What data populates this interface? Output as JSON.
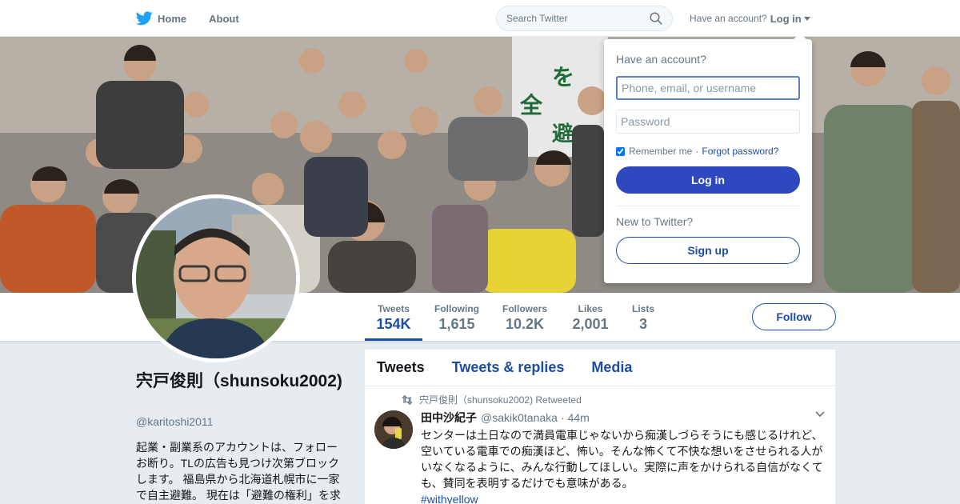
{
  "nav": {
    "home_label": "Home",
    "about_label": "About",
    "search_placeholder": "Search Twitter",
    "account_prompt": "Have an account?",
    "login_label": "Log in"
  },
  "login_dropdown": {
    "heading": "Have an account?",
    "username_placeholder": "Phone, email, or username",
    "password_placeholder": "Password",
    "remember_label": "Remember me",
    "separator": "·",
    "forgot_label": "Forgot password?",
    "login_button": "Log in",
    "new_prompt": "New to Twitter?",
    "signup_button": "Sign up"
  },
  "profile": {
    "name": "宍戸俊則（shunsoku2002)",
    "handle": "@karitoshi2011",
    "bio": "起業・副業系のアカウントは、フォローお断り。TLの広告も見つけ次第ブロックします。 福島県から北海道札幌市に一家で自主避難。 現在は「避難の権利」を求",
    "follow_button": "Follow"
  },
  "stats": [
    {
      "label": "Tweets",
      "value": "154K"
    },
    {
      "label": "Following",
      "value": "1,615"
    },
    {
      "label": "Followers",
      "value": "10.2K"
    },
    {
      "label": "Likes",
      "value": "2,001"
    },
    {
      "label": "Lists",
      "value": "3"
    }
  ],
  "timeline": {
    "tabs": [
      "Tweets",
      "Tweets & replies",
      "Media"
    ],
    "tweet": {
      "retweet_note": "宍戸俊則（shunsoku2002) Retweeted",
      "author_name": "田中沙紀子",
      "author_handle": "@sakik0tanaka",
      "separator": "·",
      "time": "44m",
      "text": "センターは土日なので満員電車じゃないから痴漢しづらそうにも感じるけれど、空いている電車での痴漢ほど、怖い。そんな怖くて不快な想いをさせられる人がいなくなるように、みんな行動してほしい。実際に声をかけられる自信がなくても、賛同を表明するだけでも意味がある。",
      "hashtag": "#withyellow"
    }
  },
  "colors": {
    "accent": "#1c4da5",
    "login_button": "#2e48bf",
    "twitter_blue": "#1da1f2",
    "background": "#e6ecf0"
  },
  "icons": [
    "twitter-bird-icon",
    "search-icon",
    "caret-down-icon",
    "retweet-icon",
    "chevron-down-icon"
  ]
}
